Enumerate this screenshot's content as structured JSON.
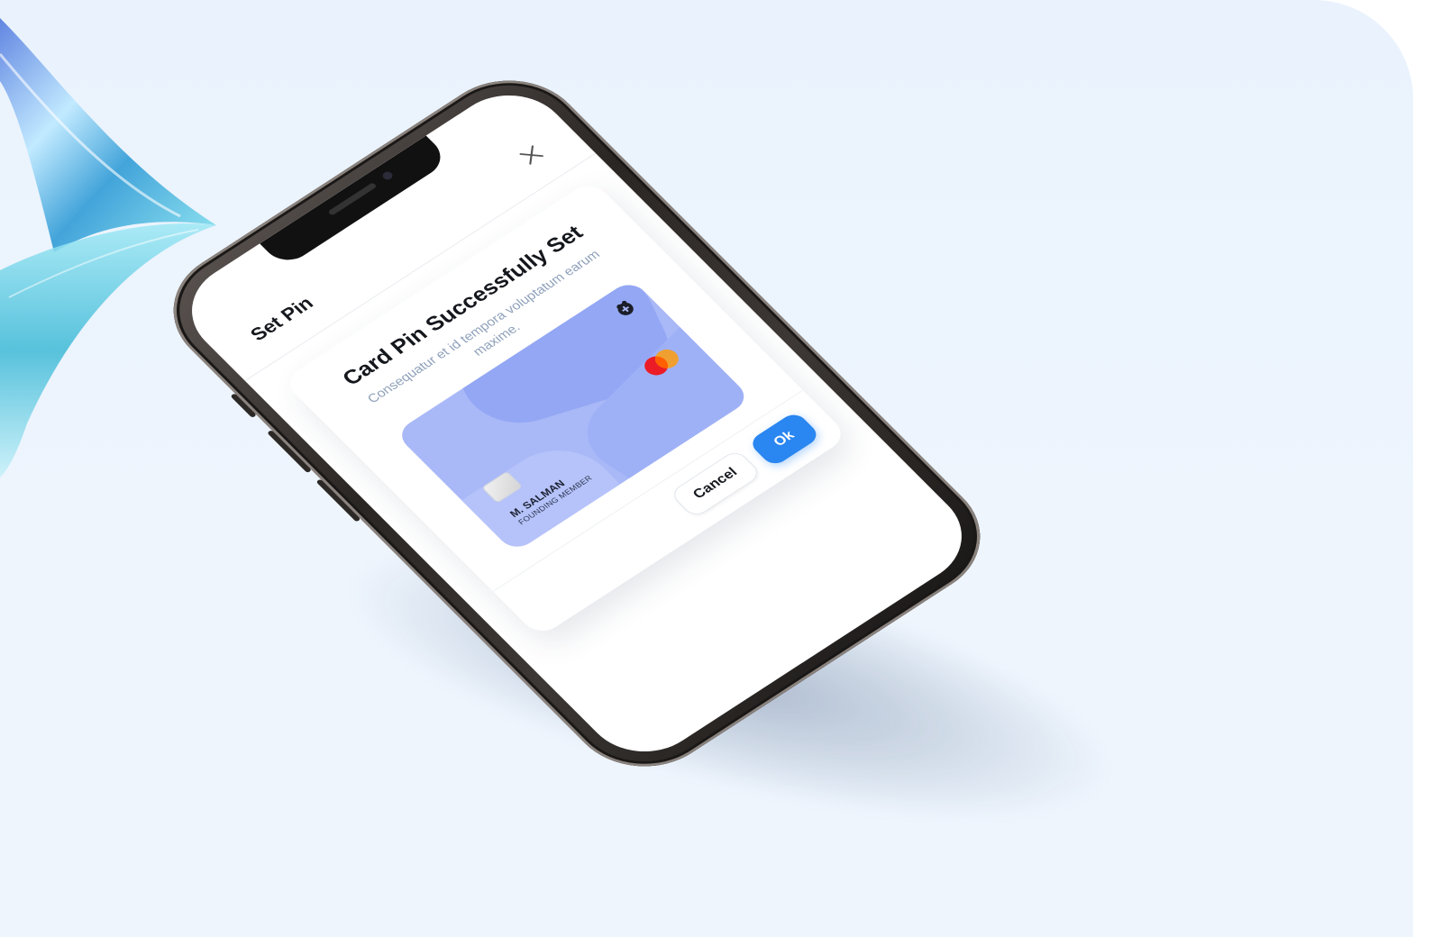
{
  "screen": {
    "header_title": "Set Pin",
    "close_icon": "close-icon"
  },
  "modal": {
    "title": "Card Pin Successfully Set",
    "subtitle": "Consequatur et id tempora voluptatum earum maxime.",
    "card": {
      "holder_name": "M. SALMAN",
      "membership": "FOUNDING MEMBER",
      "brand_icon": "mastercard-icon",
      "issuer_icon": "issuer-logo-icon",
      "chip_icon": "chip-icon"
    },
    "buttons": {
      "cancel": "Cancel",
      "ok": "Ok"
    }
  },
  "colors": {
    "accent": "#2a86f0",
    "card": "#a9b8f7",
    "background": "#eaf3fd"
  }
}
